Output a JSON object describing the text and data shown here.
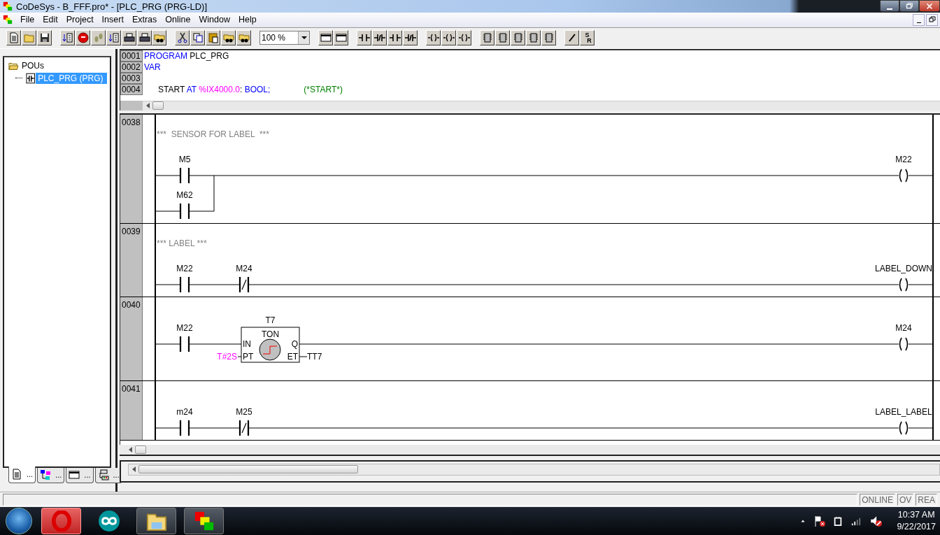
{
  "window": {
    "title": "CoDeSys - B_FFF.pro* - [PLC_PRG (PRG-LD)]"
  },
  "menu": [
    "File",
    "Edit",
    "Project",
    "Insert",
    "Extras",
    "Online",
    "Window",
    "Help"
  ],
  "toolbar": {
    "zoom": "100 %",
    "set_reset": {
      "upper": "S",
      "lower": "R"
    }
  },
  "object_tree": {
    "items": [
      {
        "label": "POUs",
        "expanded": true,
        "selected": false,
        "children": [
          {
            "label": "PLC_PRG (PRG)",
            "selected": true
          }
        ]
      }
    ]
  },
  "object_tabs": [
    {
      "label": "...",
      "selected": true
    },
    {
      "label": "...",
      "selected": false
    },
    {
      "label": "...",
      "selected": false
    },
    {
      "label": "...",
      "selected": false
    }
  ],
  "declaration": {
    "lines": [
      {
        "number": "0001",
        "segments": [
          {
            "text": "PROGRAM",
            "kind": "keyword"
          },
          {
            "text": " PLC_PRG",
            "kind": "plain"
          }
        ]
      },
      {
        "number": "0002",
        "segments": [
          {
            "text": "VAR",
            "kind": "keyword"
          }
        ]
      },
      {
        "number": "0003"
      },
      {
        "number": "0004",
        "indented": true,
        "segments": [
          {
            "text": "START",
            "kind": "plain"
          },
          {
            "text": " AT ",
            "kind": "keyword"
          },
          {
            "text": "%IX4000.0",
            "kind": "address"
          },
          {
            "text": ": ",
            "kind": "plain"
          },
          {
            "text": "BOOL;",
            "kind": "keyword"
          },
          {
            "text": "(*START*)",
            "kind": "comment"
          }
        ]
      }
    ]
  },
  "networks": [
    {
      "number": "0038",
      "comment": "***  SENSOR FOR LABEL  ***",
      "elements": [
        {
          "kind": "contact",
          "label": "M5",
          "negated": false
        }
      ],
      "parallel": [
        {
          "kind": "contact",
          "label": "M62",
          "negated": false
        }
      ],
      "coil": {
        "label": "M22"
      }
    },
    {
      "number": "0039",
      "comment": "*** LABEL ***",
      "elements": [
        {
          "kind": "contact",
          "label": "M22",
          "negated": false
        },
        {
          "kind": "contact",
          "label": "M24",
          "negated": true
        }
      ],
      "coil": {
        "label": "LABEL_DOWN"
      }
    },
    {
      "number": "0040",
      "elements": [
        {
          "kind": "contact",
          "label": "M22",
          "negated": false
        },
        {
          "kind": "box",
          "instance": "T7",
          "type": "TON",
          "inputs": [
            "IN",
            "PT"
          ],
          "outputs": [
            "Q",
            "ET"
          ],
          "pt_value": "T#2S",
          "et_var": "TT7"
        }
      ],
      "coil": {
        "label": "M24"
      }
    },
    {
      "number": "0041",
      "elements": [
        {
          "kind": "contact",
          "label": "m24",
          "negated": false
        },
        {
          "kind": "contact",
          "label": "M25",
          "negated": true
        }
      ],
      "coil": {
        "label": "LABEL_LABEL"
      }
    }
  ],
  "status_bar": {
    "indicators": [
      "ONLINE",
      "OV",
      "REA"
    ]
  },
  "taskbar": {
    "apps": [
      {
        "kind": "browser"
      },
      {
        "kind": "arduino"
      },
      {
        "kind": "explorer"
      },
      {
        "kind": "codesys"
      }
    ],
    "time": "10:37 AM",
    "date": "9/22/2017"
  }
}
